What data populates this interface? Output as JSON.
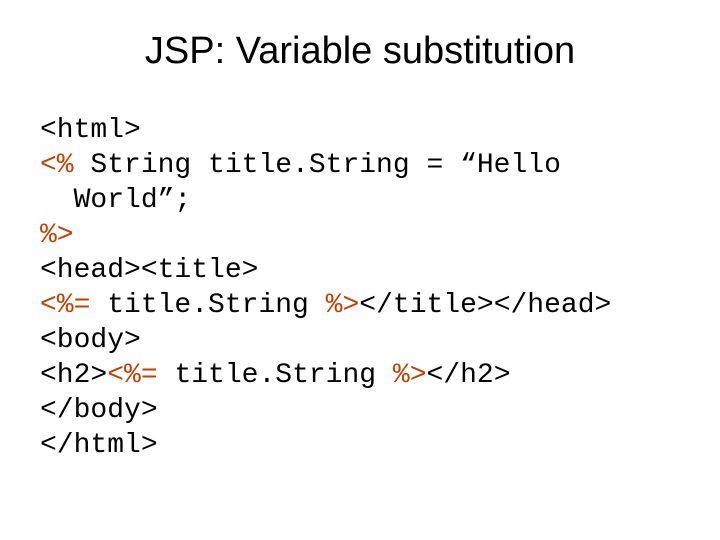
{
  "title": "JSP: Variable substitution",
  "code": {
    "line1": "<html>",
    "line2_hl": "<%",
    "line2_rest": " String title.String = “Hello",
    "line3": "  World”;",
    "line4_hl": "%>",
    "line5": "<head><title>",
    "line6_hl": "<%=",
    "line6_mid": " title.String ",
    "line6_hl2": "%>",
    "line6_end": "</title></head>",
    "line7": "<body>",
    "line8_start": "<h2>",
    "line8_hl": "<%=",
    "line8_mid": " title.String ",
    "line8_hl2": "%>",
    "line8_end": "</h2>",
    "line9": "</body>",
    "line10": "</html>"
  }
}
